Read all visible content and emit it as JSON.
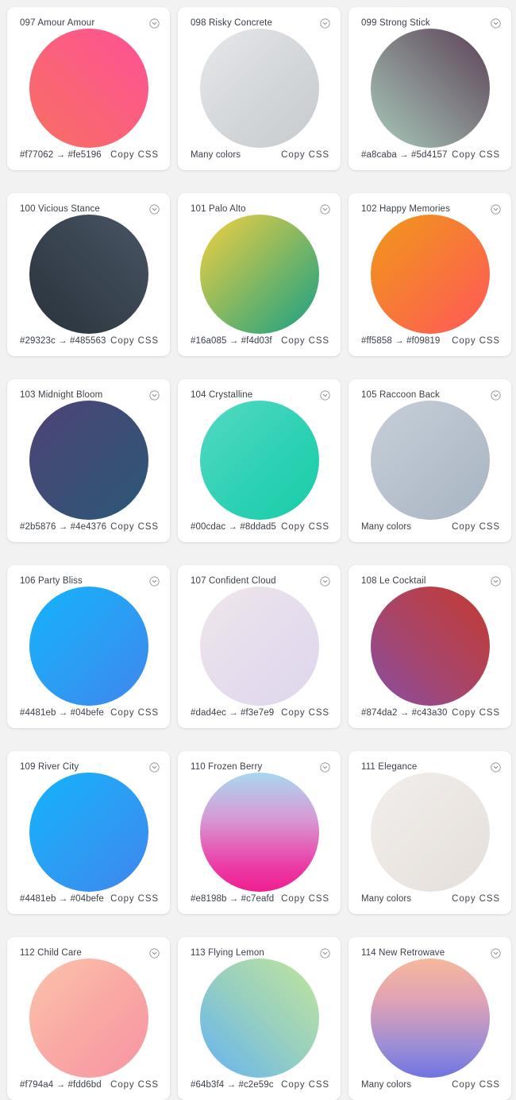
{
  "page": {
    "background_color": "#f2f2f2",
    "card_background_color": "#ffffff",
    "text_color": "#3a3f47",
    "columns": 3
  },
  "labels": {
    "copy_css": "Copy CSS",
    "many_colors": "Many colors",
    "arrow": "→",
    "menu_icon": "chevron-down-circle-icon"
  },
  "cards": [
    {
      "title": "097 Amour Amour",
      "from": "#f77062",
      "to": "#fe5196",
      "hex_text": "#f77062 → #fe5196",
      "many_colors": false,
      "gradient": "linear-gradient(to top right, #f77062 0%, #fe5196 100%)",
      "copy_label": "Copy CSS"
    },
    {
      "title": "098 Risky Concrete",
      "from": "#e2e4e6",
      "to": "#c9ccd0",
      "hex_text": "Many colors",
      "many_colors": true,
      "gradient": "linear-gradient(to bottom right, #e6e8ea 0%, #d3d6d9 55%, #c7cace 100%)",
      "copy_label": "Copy CSS"
    },
    {
      "title": "099 Strong Stick",
      "from": "#a8caba",
      "to": "#5d4157",
      "hex_text": "#a8caba → #5d4157",
      "many_colors": false,
      "gradient": "linear-gradient(to top right, #a8caba 0%, #5d4157 100%)",
      "copy_label": "Copy CSS"
    },
    {
      "title": "100 Vicious Stance",
      "from": "#29323c",
      "to": "#485563",
      "hex_text": "#29323c → #485563",
      "many_colors": false,
      "gradient": "linear-gradient(to top right, #29323c 0%, #485563 100%)",
      "copy_label": "Copy CSS"
    },
    {
      "title": "101 Palo Alto",
      "from": "#16a085",
      "to": "#f4d03f",
      "hex_text": "#16a085 → #f4d03f",
      "many_colors": false,
      "gradient": "linear-gradient(to bottom right, #f4d03f 0%, #16a085 100%)",
      "copy_label": "Copy CSS"
    },
    {
      "title": "102 Happy Memories",
      "from": "#ff5858",
      "to": "#f09819",
      "hex_text": "#ff5858 → #f09819",
      "many_colors": false,
      "gradient": "linear-gradient(to bottom right, #f09819 0%, #ff5858 100%)",
      "copy_label": "Copy CSS"
    },
    {
      "title": "103 Midnight Bloom",
      "from": "#2b5876",
      "to": "#4e4376",
      "hex_text": "#2b5876 → #4e4376",
      "many_colors": false,
      "gradient": "linear-gradient(to bottom right, #4e4376 0%, #2b5876 100%)",
      "copy_label": "Copy CSS"
    },
    {
      "title": "104 Crystalline",
      "from": "#00cdac",
      "to": "#8ddad5",
      "hex_text": "#00cdac → #8ddad5",
      "many_colors": false,
      "gradient": "linear-gradient(to bottom right, #54d9c4 0%, #2ed1b4 55%, #17cda8 100%)",
      "copy_label": "Copy CSS"
    },
    {
      "title": "105 Raccoon Back",
      "from": "#c3cbd6",
      "to": "#aab7c4",
      "hex_text": "Many colors",
      "many_colors": true,
      "gradient": "linear-gradient(to bottom right, #c6ced8 0%, #b6c0cc 55%, #a8b4c2 100%)",
      "copy_label": "Copy CSS"
    },
    {
      "title": "106 Party Bliss",
      "from": "#4481eb",
      "to": "#04befe",
      "hex_text": "#4481eb → #04befe",
      "many_colors": false,
      "gradient": "linear-gradient(to bottom right, #13b3fb 0%, #2b9ef4 50%, #3f86ec 100%)",
      "copy_label": "Copy CSS"
    },
    {
      "title": "107 Confident Cloud",
      "from": "#dad4ec",
      "to": "#f3e7e9",
      "hex_text": "#dad4ec → #f3e7e9",
      "many_colors": false,
      "gradient": "linear-gradient(to bottom right, #efe6ea 0%, #e5dced 55%, #ded6ec 100%)",
      "copy_label": "Copy CSS"
    },
    {
      "title": "108 Le Cocktail",
      "from": "#874da2",
      "to": "#c43a30",
      "hex_text": "#874da2 → #c43a30",
      "many_colors": false,
      "gradient": "linear-gradient(to bottom left, #c43a30 0%, #a8456a 55%, #874da2 100%)",
      "copy_label": "Copy CSS"
    },
    {
      "title": "109 River City",
      "from": "#4481eb",
      "to": "#04befe",
      "hex_text": "#4481eb → #04befe",
      "many_colors": false,
      "gradient": "linear-gradient(to bottom right, #13b3fb 0%, #2b9ef4 50%, #3f86ec 100%)",
      "copy_label": "Copy CSS"
    },
    {
      "title": "110 Frozen Berry",
      "from": "#e8198b",
      "to": "#c7eafd",
      "hex_text": "#e8198b → #c7eafd",
      "many_colors": false,
      "gradient": "linear-gradient(to bottom, #a8d8f0 0%, #d69bd6 38%, #ec39a4 80%, #ef1e8f 100%)",
      "copy_label": "Copy CSS"
    },
    {
      "title": "111 Elegance",
      "from": "#f0ece9",
      "to": "#e6e0dc",
      "hex_text": "Many colors",
      "many_colors": true,
      "gradient": "linear-gradient(to bottom right, #f2eeeb 0%, #ebe6e2 55%, #e5dfdb 100%)",
      "copy_label": "Copy CSS"
    },
    {
      "title": "112 Child Care",
      "from": "#f794a4",
      "to": "#fdd6bd",
      "hex_text": "#f794a4 → #fdd6bd",
      "many_colors": false,
      "gradient": "linear-gradient(to bottom right, #fbc4ab 0%, #f9a9a4 50%, #f794a4 100%)",
      "copy_label": "Copy CSS"
    },
    {
      "title": "113 Flying Lemon",
      "from": "#64b3f4",
      "to": "#c2e59c",
      "hex_text": "#64b3f4 → #c2e59c",
      "many_colors": false,
      "gradient": "linear-gradient(to bottom left, #c2e59c 0%, #96cfc0 50%, #64b3f4 100%)",
      "copy_label": "Copy CSS"
    },
    {
      "title": "114 New Retrowave",
      "from": "#f7b199",
      "to": "#6a6fe0",
      "hex_text": "Many colors",
      "many_colors": true,
      "gradient": "linear-gradient(to bottom, #f6b89c 0%, #e0a2b4 35%, #9f8fd4 72%, #6f74e2 100%)",
      "copy_label": "Copy CSS"
    }
  ]
}
